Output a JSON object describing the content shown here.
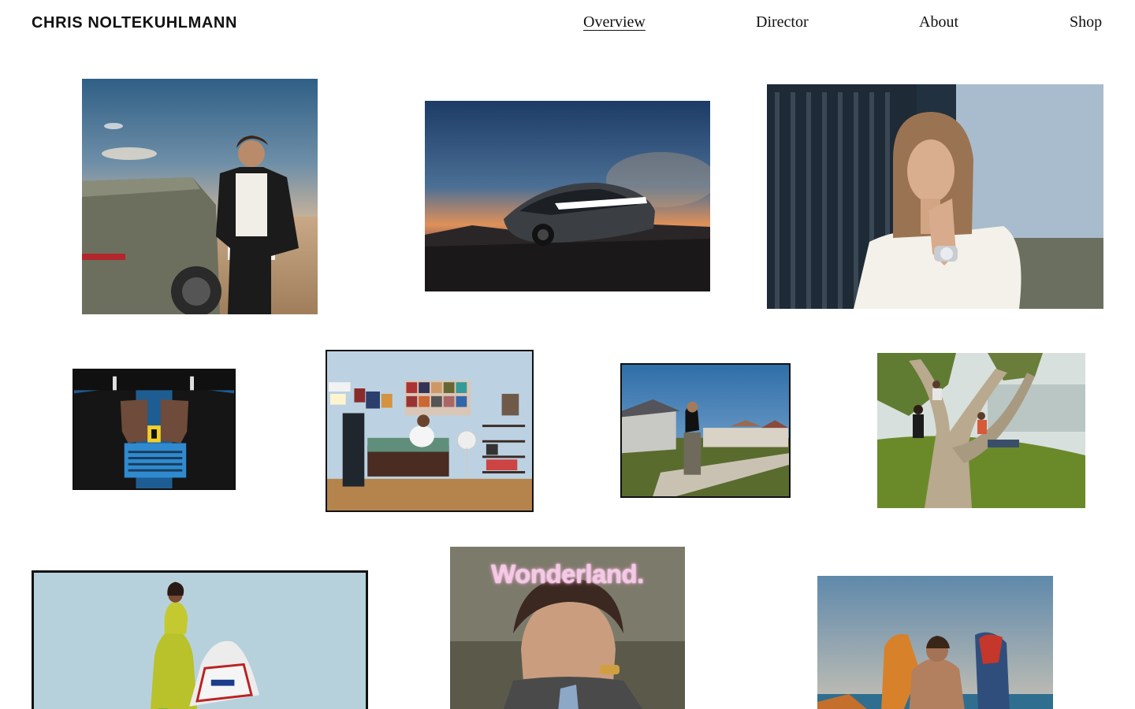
{
  "site": {
    "name": "CHRIS NOLTEKUHLMANN"
  },
  "nav": {
    "items": [
      {
        "label": "Overview",
        "active": true
      },
      {
        "label": "Director",
        "active": false
      },
      {
        "label": "About",
        "active": false
      },
      {
        "label": "Shop",
        "active": false
      }
    ]
  },
  "gallery": {
    "wonderland_cover_title": "Wonderland."
  },
  "colors": {
    "background": "#ffffff",
    "text": "#111111",
    "magazine_title": "#f6c8e6"
  }
}
